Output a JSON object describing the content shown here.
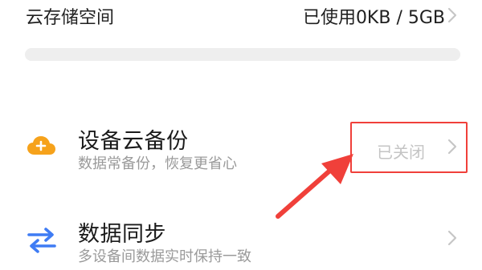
{
  "storage": {
    "label": "云存储空间",
    "usage_text": "已使用0KB / 5GB",
    "used_fraction": 0.0
  },
  "items": [
    {
      "title": "设备云备份",
      "subtitle": "数据常备份，恢复更省心",
      "status": "已关闭",
      "icon": "cloud-icon"
    },
    {
      "title": "数据同步",
      "subtitle": "多设备间数据实时保持一致",
      "icon": "sync-arrows-icon"
    }
  ],
  "colors": {
    "accent_orange": "#f6a21b",
    "sync_blue": "#3f7cf4",
    "annotation_red": "#f0403a",
    "muted_text": "#9a9a9a",
    "disabled_text": "#c4c4c4"
  }
}
